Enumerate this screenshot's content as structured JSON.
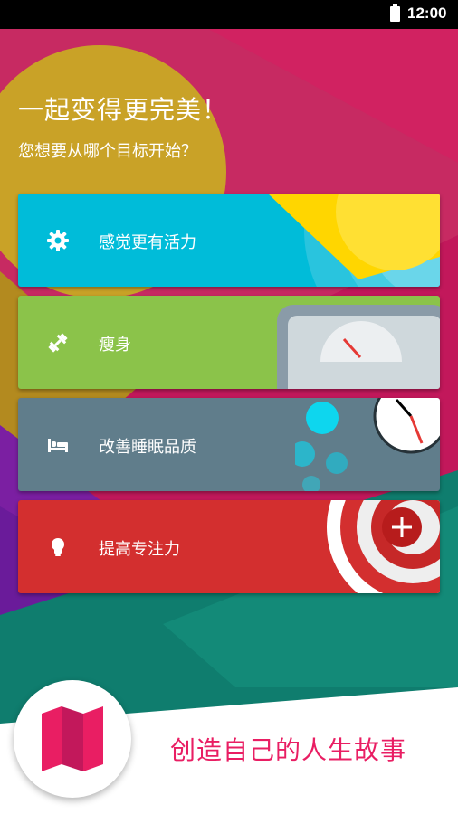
{
  "status_bar": {
    "time": "12:00"
  },
  "header": {
    "title": "一起变得更完美！",
    "subtitle": "您想要从哪个目标开始？"
  },
  "goals": [
    {
      "label": "感觉更有活力",
      "icon": "gear-icon",
      "color": "#00bcd9"
    },
    {
      "label": "瘦身",
      "icon": "dumbbell-icon",
      "color": "#8bc34a"
    },
    {
      "label": "改善睡眠品质",
      "icon": "bed-icon",
      "color": "#607d8b"
    },
    {
      "label": "提高专注力",
      "icon": "lightbulb-icon",
      "color": "#d32f2f"
    }
  ],
  "footer": {
    "slogan": "创造自己的人生故事"
  },
  "accent_color": "#e91e63"
}
